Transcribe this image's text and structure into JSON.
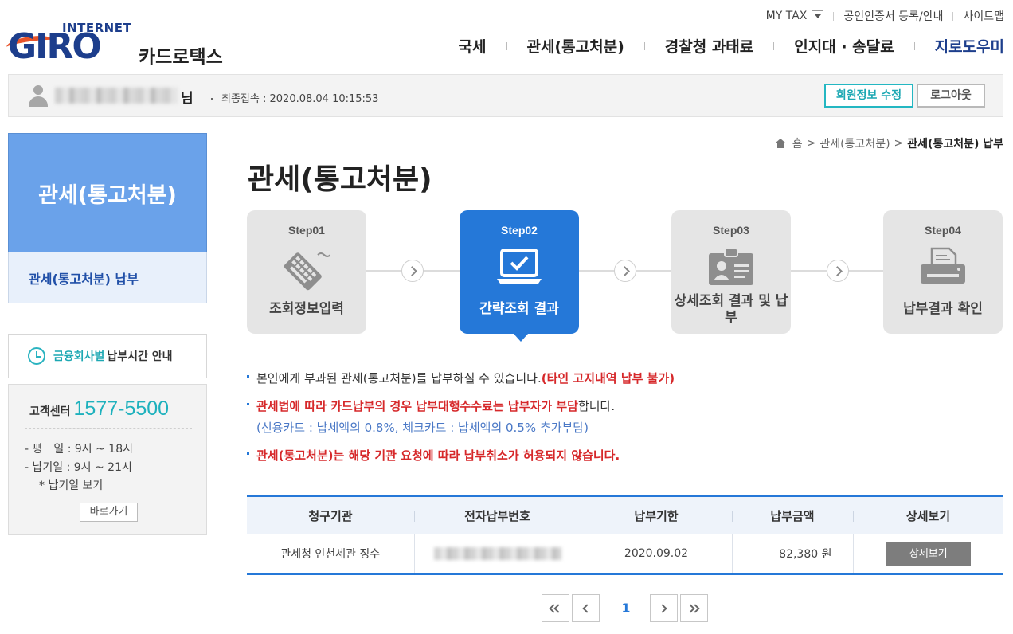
{
  "header": {
    "logo_internet": "INTERNET",
    "logo_giro": "GIRO",
    "logo_sub": "카드로택스",
    "util": [
      "MY TAX",
      "공인인증서 등록/안내",
      "사이트맵"
    ],
    "gnb": [
      "국세",
      "관세(통고처분)",
      "경찰청 과태료",
      "인지대 · 송달료",
      "지로도우미"
    ]
  },
  "userbar": {
    "suffix": "님",
    "last_login_label": "최종접속 :",
    "last_login_value": "2020.08.04 10:15:53",
    "edit_button": "회원정보 수정",
    "logout_button": "로그아웃"
  },
  "sidebar": {
    "title": "관세(통고처분)",
    "sub_item": "관세(통고처분) 납부",
    "paytime_highlight": "금융회사별",
    "paytime_rest": "납부시간 안내",
    "cs_label": "고객센터",
    "cs_phone": "1577-5500",
    "hours_weekday": "- 평　일 : 9시 ~ 18시",
    "hours_dueday": "- 납기일 : 9시 ~ 21시",
    "hours_note": "* 납기일 보기",
    "shortcut_button": "바로가기"
  },
  "breadcrumb": {
    "home": "홈",
    "mid": "관세(통고처분)",
    "current": "관세(통고처분) 납부"
  },
  "page_title": "관세(통고처분)",
  "steps": [
    {
      "num": "Step01",
      "label": "조회정보입력"
    },
    {
      "num": "Step02",
      "label": "간략조회 결과"
    },
    {
      "num": "Step03",
      "label": "상세조회 결과 및 납부"
    },
    {
      "num": "Step04",
      "label": "납부결과 확인"
    }
  ],
  "notes": {
    "n1_text": "본인에게 부과된 관세(통고처분)를 납부하실 수 있습니다.",
    "n1_red": "(타인 고지내역 납부 불가)",
    "n2_red": "관세법에 따라 카드납부의 경우 납부대행수수료는 납부자가 부담",
    "n2_text": "합니다.",
    "n2_sub": "(신용카드 : 납세액의 0.8%, 체크카드 : 납세액의 0.5% 추가부담)",
    "n3_red": "관세(통고처분)는 해당 기관 요청에 따라 납부취소가 허용되지 않습니다."
  },
  "table": {
    "headers": [
      "청구기관",
      "전자납부번호",
      "납부기한",
      "납부금액",
      "상세보기"
    ],
    "row": {
      "agency": "관세청 인천세관 징수",
      "due_date": "2020.09.02",
      "amount": "82,380 원",
      "detail_button": "상세보기"
    }
  },
  "pagination": {
    "current": "1"
  },
  "colors": {
    "primary": "#2578d8",
    "brand": "#1d3e8c",
    "accent": "#1da8b3",
    "warning": "#d6282a"
  }
}
